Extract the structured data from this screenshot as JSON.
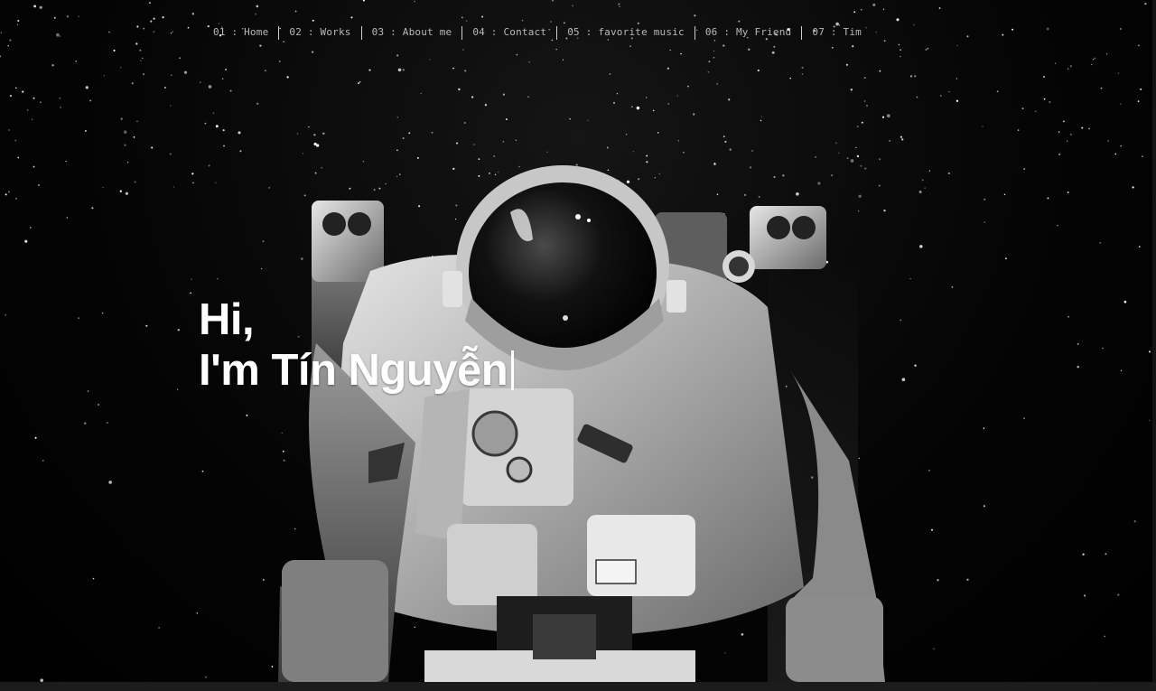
{
  "nav": {
    "items": [
      {
        "label": "01 : Home"
      },
      {
        "label": "02 : Works"
      },
      {
        "label": "03 : About me"
      },
      {
        "label": "04 : Contact"
      },
      {
        "label": "05 : favorite music"
      },
      {
        "label": "06 : My Friend"
      },
      {
        "label": "07 : Tim"
      }
    ]
  },
  "hero": {
    "line1": "Hi,",
    "line2": "I'm Tín Nguyễn"
  },
  "background": {
    "image": "astronaut-in-space",
    "colors": {
      "sky": "#000000",
      "suit": "#cfcfcf",
      "text": "#ffffff",
      "nav_text": "#b9b9b9"
    }
  }
}
